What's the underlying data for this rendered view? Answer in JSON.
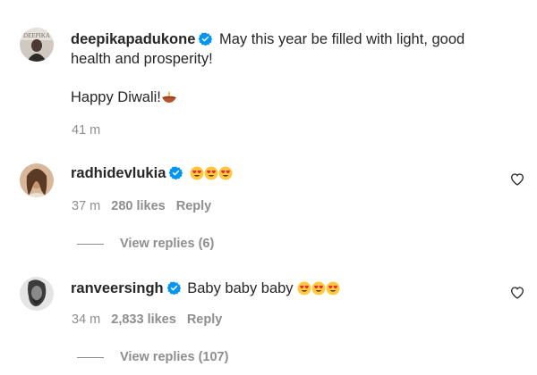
{
  "post": {
    "username": "deepikapadukone",
    "verified": true,
    "caption_line1": "May this year be filled with light, good",
    "caption_line2": "health and prosperity!",
    "caption_line3": "Happy Diwali!",
    "caption_emoji": "diya-lamp-icon",
    "time": "41 m"
  },
  "comments": [
    {
      "username": "radhidevlukia",
      "verified": true,
      "text": "",
      "emojis": [
        "heart-eyes-emoji",
        "heart-eyes-emoji",
        "heart-eyes-emoji"
      ],
      "time": "37 m",
      "likes": "280 likes",
      "reply_label": "Reply",
      "view_replies": "View replies (6)"
    },
    {
      "username": "ranveersingh",
      "verified": true,
      "text": "Baby baby baby",
      "emojis": [
        "heart-eyes-emoji",
        "heart-eyes-emoji",
        "heart-eyes-emoji"
      ],
      "time": "34 m",
      "likes": "2,833 likes",
      "reply_label": "Reply",
      "view_replies": "View replies (107)"
    }
  ],
  "colors": {
    "text": "#262626",
    "secondary": "#8e8e8e",
    "verified": "#0095f6"
  }
}
